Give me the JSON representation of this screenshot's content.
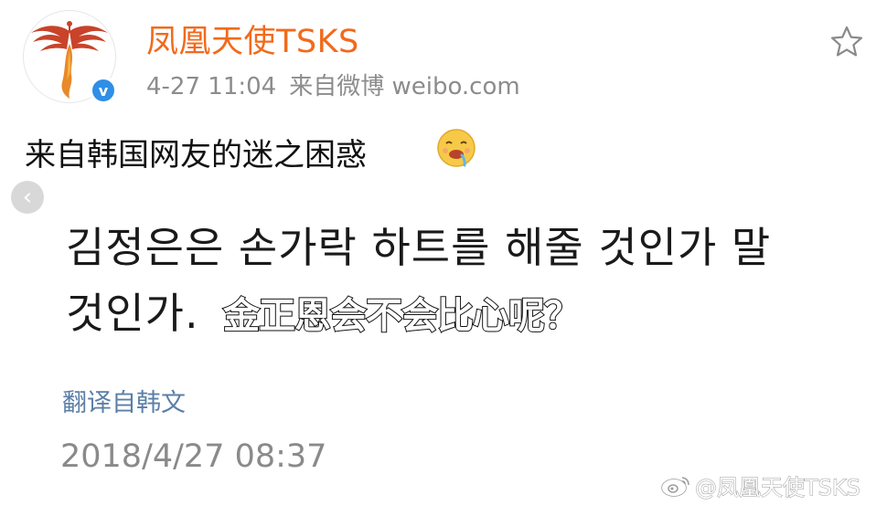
{
  "header": {
    "username": "凤凰天使TSKS",
    "time": "4-27 11:04",
    "source": "来自微博 weibo.com",
    "verified_badge": "v"
  },
  "post": {
    "text": "来自韩国网友的迷之困惑",
    "korean_line1": "김정은은 손가락 하트를 해줄 것인가 말",
    "korean_line2": "것인가.",
    "chinese_caption": "金正恩会不会比心呢？",
    "translate_link": "翻译自韩文",
    "timestamp": "2018/4/27 08:37"
  },
  "watermark": {
    "text": "@凤凰天使TSKS"
  },
  "icons": {
    "avatar_logo": "phoenix-logo",
    "favorite": "star-icon",
    "emoji": "drooling-face-emoji",
    "back": "chevron-left-icon",
    "watermark_logo": "weibo-logo-icon"
  },
  "colors": {
    "username": "#f26a1b",
    "link": "#5b7fa8",
    "badge": "#2f8ee6",
    "meta": "#8c8c8c"
  }
}
